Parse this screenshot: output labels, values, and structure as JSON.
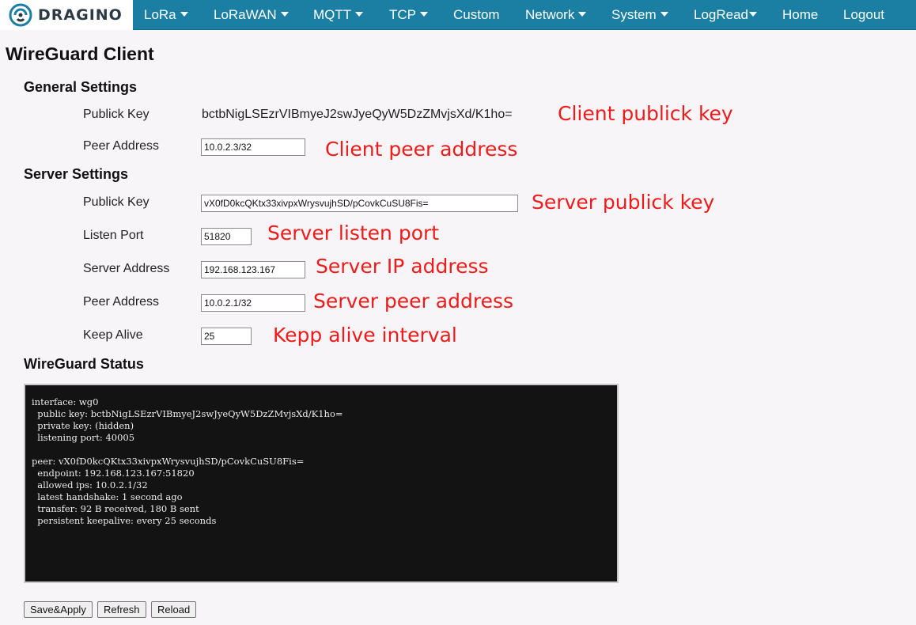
{
  "nav": {
    "logo_text": "DRAGINO",
    "items": [
      {
        "label": "LoRa",
        "dropdown": true
      },
      {
        "label": "LoRaWAN",
        "dropdown": true
      },
      {
        "label": "MQTT",
        "dropdown": true
      },
      {
        "label": "TCP",
        "dropdown": true
      },
      {
        "label": "Custom",
        "dropdown": false
      },
      {
        "label": "Network",
        "dropdown": true
      },
      {
        "label": "System",
        "dropdown": true
      },
      {
        "label": "LogRead",
        "dropdown": true
      },
      {
        "label": "Home",
        "dropdown": false
      },
      {
        "label": "Logout",
        "dropdown": false
      }
    ],
    "colors": {
      "bar": "#1b7ea3",
      "text": "#ffffff"
    }
  },
  "page": {
    "title": "WireGuard Client"
  },
  "general": {
    "title": "General Settings",
    "public_key_label": "Publick Key",
    "public_key_value": "bctbNigLSEzrVIBmyeJ2swJyeQyW5DzZMvjsXd/K1ho=",
    "peer_address_label": "Peer Address",
    "peer_address_value": "10.0.2.3/32"
  },
  "server": {
    "title": "Server Settings",
    "public_key_label": "Publick Key",
    "public_key_value": "vX0fD0kcQKtx33xivpxWrysvujhSD/pCovkCuSU8Fis=",
    "listen_port_label": "Listen Port",
    "listen_port_value": "51820",
    "server_address_label": "Server Address",
    "server_address_value": "192.168.123.167",
    "peer_address_label": "Peer Address",
    "peer_address_value": "10.0.2.1/32",
    "keep_alive_label": "Keep Alive",
    "keep_alive_value": "25"
  },
  "annotations": {
    "client_public_key": "Client publick key",
    "client_peer_address": "Client peer address",
    "server_public_key": "Server publick key",
    "server_listen_port": "Server listen port",
    "server_ip_address": "Server IP address",
    "server_peer_address": "Server peer address",
    "keep_alive_interval": "Kepp alive interval",
    "color": "#ee1b1b"
  },
  "status": {
    "title": "WireGuard Status",
    "text": "interface: wg0\n  public key: bctbNigLSEzrVIBmyeJ2swJyeQyW5DzZMvjsXd/K1ho=\n  private key: (hidden)\n  listening port: 40005\n\npeer: vX0fD0kcQKtx33xivpxWrysvujhSD/pCovkCuSU8Fis=\n  endpoint: 192.168.123.167:51820\n  allowed ips: 10.0.2.1/32\n  latest handshake: 1 second ago\n  transfer: 92 B received, 180 B sent\n  persistent keepalive: every 25 seconds"
  },
  "buttons": {
    "save_apply": "Save&Apply",
    "refresh": "Refresh",
    "reload": "Reload"
  }
}
